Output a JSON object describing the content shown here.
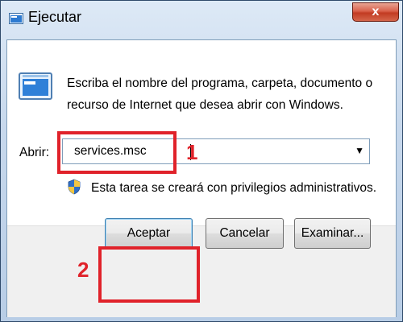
{
  "window": {
    "title": "Ejecutar",
    "close_label": "x"
  },
  "run": {
    "description": "Escriba el nombre del programa, carpeta, documento o recurso de Internet que desea abrir con Windows.",
    "open_label": "Abrir:",
    "open_value": "services.msc",
    "admin_note": "Esta tarea se creará con privilegios administrativos."
  },
  "buttons": {
    "ok": "Aceptar",
    "cancel": "Cancelar",
    "browse": "Examinar..."
  },
  "annotations": {
    "step1": "1",
    "step2": "2"
  },
  "icons": {
    "title": "run-icon",
    "main": "run-icon",
    "uac": "uac-shield-icon",
    "dropdown": "chevron-down-icon"
  },
  "colors": {
    "annotation": "#e0222a",
    "close_button": "#c23b22"
  }
}
